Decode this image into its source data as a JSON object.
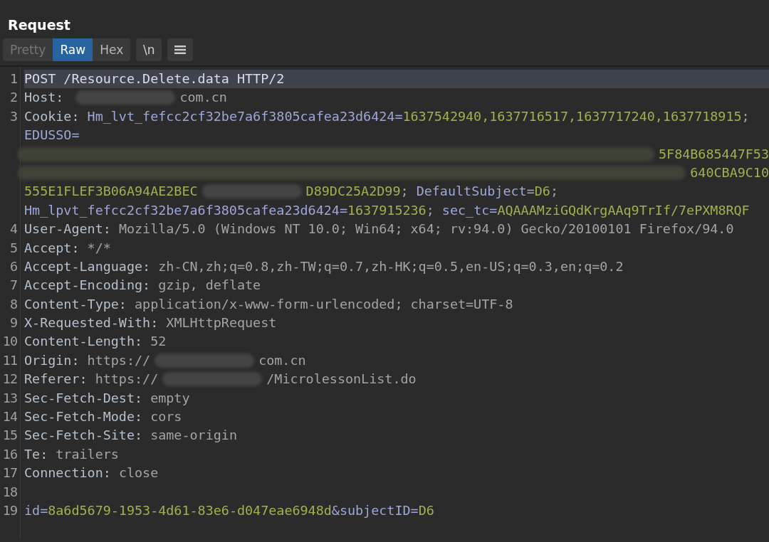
{
  "panel": {
    "title": "Request"
  },
  "view_tabs": [
    {
      "label": "Pretty",
      "selected": false
    },
    {
      "label": "Raw",
      "selected": true
    },
    {
      "label": "Hex",
      "selected": false
    }
  ],
  "toolbar_buttons": [
    {
      "kind": "text",
      "label": "\\n"
    },
    {
      "kind": "menu"
    }
  ],
  "lines": [
    {
      "number": "1",
      "selected": true,
      "segments": [
        {
          "kind": "plain",
          "text": "POST /Resource.Delete.data HTTP/2"
        }
      ]
    },
    {
      "number": "2",
      "selected": false,
      "segments": [
        {
          "kind": "header",
          "text": "Host: "
        },
        {
          "kind": "redacted"
        },
        {
          "kind": "text",
          "text": "com.cn"
        }
      ]
    },
    {
      "number": "3",
      "selected": false,
      "segments": [
        {
          "kind": "header",
          "text": "Cookie: "
        },
        {
          "kind": "name",
          "text": "Hm_lvt_fefcc2cf32be7a6f3805cafea23d6424="
        },
        {
          "kind": "value",
          "text": "1637542940,1637716517,1637717240,1637718915"
        },
        {
          "kind": "text",
          "text": ";"
        }
      ]
    },
    {
      "selected": false,
      "segments": [
        {
          "kind": "name",
          "text": "EDUSSO="
        }
      ]
    },
    {
      "selected": false,
      "segments": [
        {
          "kind": "redacted"
        },
        {
          "kind": "value",
          "text": "5F84B685447F53"
        }
      ]
    },
    {
      "selected": false,
      "segments": [
        {
          "kind": "redacted"
        },
        {
          "kind": "value",
          "text": "640CBA9C10"
        }
      ]
    },
    {
      "selected": false,
      "segments": [
        {
          "kind": "value",
          "text": "555E1FLEF3B06A94AE2BEC"
        },
        {
          "kind": "redacted"
        },
        {
          "kind": "value",
          "text": "D89DC25A2D99"
        },
        {
          "kind": "text",
          "text": "; "
        },
        {
          "kind": "name",
          "text": "DefaultSubject="
        },
        {
          "kind": "value",
          "text": "D6"
        },
        {
          "kind": "text",
          "text": ";"
        }
      ]
    },
    {
      "selected": false,
      "segments": [
        {
          "kind": "name",
          "text": "Hm_lpvt_fefcc2cf32be7a6f3805cafea23d6424="
        },
        {
          "kind": "value",
          "text": "1637915236"
        },
        {
          "kind": "text",
          "text": "; "
        },
        {
          "kind": "name",
          "text": "sec_tc="
        },
        {
          "kind": "value",
          "text": "AQAAAMziGQdKrgAAq9TrIf/7ePXM8RQF"
        }
      ]
    },
    {
      "number": "4",
      "selected": false,
      "segments": [
        {
          "kind": "header",
          "text": "User-Agent: "
        },
        {
          "kind": "text",
          "text": "Mozilla/5.0 (Windows NT 10.0; Win64; x64; rv:94.0) Gecko/20100101 Firefox/94.0"
        }
      ]
    },
    {
      "number": "5",
      "selected": false,
      "segments": [
        {
          "kind": "header",
          "text": "Accept: "
        },
        {
          "kind": "text",
          "text": "*/*"
        }
      ]
    },
    {
      "number": "6",
      "selected": false,
      "segments": [
        {
          "kind": "header",
          "text": "Accept-Language: "
        },
        {
          "kind": "text",
          "text": "zh-CN,zh;q=0.8,zh-TW;q=0.7,zh-HK;q=0.5,en-US;q=0.3,en;q=0.2"
        }
      ]
    },
    {
      "number": "7",
      "selected": false,
      "segments": [
        {
          "kind": "header",
          "text": "Accept-Encoding: "
        },
        {
          "kind": "text",
          "text": "gzip, deflate"
        }
      ]
    },
    {
      "number": "8",
      "selected": false,
      "segments": [
        {
          "kind": "header",
          "text": "Content-Type: "
        },
        {
          "kind": "text",
          "text": "application/x-www-form-urlencoded; charset=UTF-8"
        }
      ]
    },
    {
      "number": "9",
      "selected": false,
      "segments": [
        {
          "kind": "header",
          "text": "X-Requested-With: "
        },
        {
          "kind": "text",
          "text": "XMLHttpRequest"
        }
      ]
    },
    {
      "number": "10",
      "selected": false,
      "segments": [
        {
          "kind": "header",
          "text": "Content-Length: "
        },
        {
          "kind": "text",
          "text": "52"
        }
      ]
    },
    {
      "number": "11",
      "selected": false,
      "segments": [
        {
          "kind": "header",
          "text": "Origin: "
        },
        {
          "kind": "text",
          "text": "https://"
        },
        {
          "kind": "redacted"
        },
        {
          "kind": "text",
          "text": "com.cn"
        }
      ]
    },
    {
      "number": "12",
      "selected": false,
      "segments": [
        {
          "kind": "header",
          "text": "Referer: "
        },
        {
          "kind": "text",
          "text": "https://"
        },
        {
          "kind": "redacted"
        },
        {
          "kind": "text",
          "text": "/MicrolessonList.do"
        }
      ]
    },
    {
      "number": "13",
      "selected": false,
      "segments": [
        {
          "kind": "header",
          "text": "Sec-Fetch-Dest: "
        },
        {
          "kind": "text",
          "text": "empty"
        }
      ]
    },
    {
      "number": "14",
      "selected": false,
      "segments": [
        {
          "kind": "header",
          "text": "Sec-Fetch-Mode: "
        },
        {
          "kind": "text",
          "text": "cors"
        }
      ]
    },
    {
      "number": "15",
      "selected": false,
      "segments": [
        {
          "kind": "header",
          "text": "Sec-Fetch-Site: "
        },
        {
          "kind": "text",
          "text": "same-origin"
        }
      ]
    },
    {
      "number": "16",
      "selected": false,
      "segments": [
        {
          "kind": "header",
          "text": "Te: "
        },
        {
          "kind": "text",
          "text": "trailers"
        }
      ]
    },
    {
      "number": "17",
      "selected": false,
      "segments": [
        {
          "kind": "header",
          "text": "Connection: "
        },
        {
          "kind": "text",
          "text": "close"
        }
      ]
    },
    {
      "number": "18",
      "selected": false
    },
    {
      "number": "19",
      "selected": false,
      "segments": [
        {
          "kind": "name",
          "text": "id="
        },
        {
          "kind": "value",
          "text": "8a6d5679-1953-4d61-83e6-d047eae6948d"
        },
        {
          "kind": "name",
          "text": "&subjectID="
        },
        {
          "kind": "value",
          "text": "D6"
        }
      ]
    }
  ]
}
